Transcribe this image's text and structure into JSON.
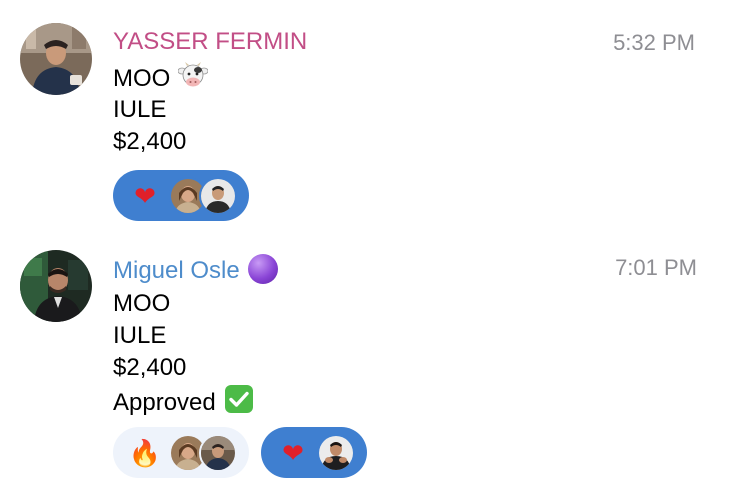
{
  "colors": {
    "sender1_name": "#c24e86",
    "sender2_name": "#4e8ccb",
    "timestamp": "#8e8e93",
    "reaction_active_bg": "#3f7fd0",
    "reaction_inactive_bg": "#eef3fb",
    "premium_badge": "#8a45d6",
    "approved_check": "#4cbb47"
  },
  "messages": [
    {
      "sender": "YASSER FERMIN",
      "time": "5:32 PM",
      "lines": [
        "MOO",
        "IULE",
        "$2,400"
      ],
      "line1_emoji": "🐮",
      "reactions": [
        {
          "emoji": "❤",
          "icon": "heart-icon",
          "active": true,
          "reactor_count": 2
        }
      ]
    },
    {
      "sender": "Miguel Osle",
      "time": "7:01 PM",
      "lines": [
        "MOO",
        "IULE",
        "$2,400",
        "Approved"
      ],
      "line4_emoji": "✅",
      "badge_icon": "premium-purple-circle-icon",
      "reactions": [
        {
          "emoji": "🔥",
          "icon": "fire-icon",
          "active": false,
          "reactor_count": 2
        },
        {
          "emoji": "❤",
          "icon": "heart-icon",
          "active": true,
          "reactor_count": 1
        }
      ]
    }
  ]
}
